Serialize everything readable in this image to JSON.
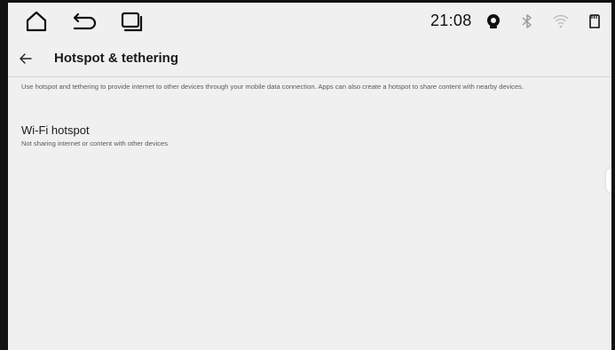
{
  "status_bar": {
    "time": "21:08",
    "icons": [
      "home-icon",
      "back-icon",
      "recents-icon",
      "location-icon",
      "bluetooth-icon",
      "wifi-icon",
      "sd-card-icon"
    ]
  },
  "app_bar": {
    "back_icon": "arrow-left-icon",
    "title": "Hotspot & tethering"
  },
  "main": {
    "description": "Use hotspot and tethering to provide internet to other devices through your mobile data connection. Apps can also create a hotspot to share content with nearby devices.",
    "preferences": [
      {
        "title": "Wi-Fi hotspot",
        "summary": "Not sharing internet or content with other devices"
      }
    ]
  },
  "colors": {
    "background": "#f0f0f0",
    "text_primary": "#1a1a1a",
    "text_secondary": "#5a5a5a",
    "divider": "#d6d6d6",
    "frame": "#111111"
  }
}
